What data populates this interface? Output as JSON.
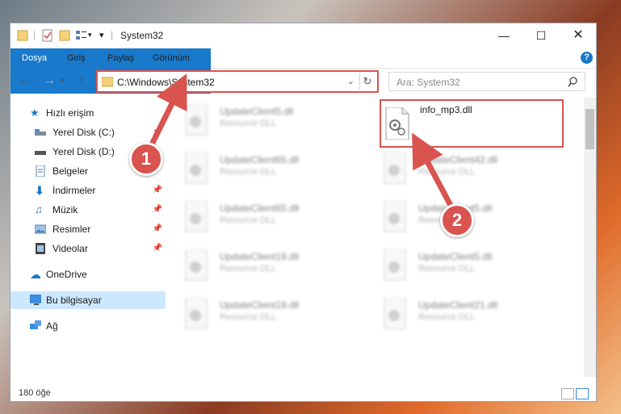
{
  "window": {
    "title": "System32"
  },
  "ribbon": {
    "tabs": [
      "Dosya",
      "Giriş",
      "Paylaş",
      "Görünüm"
    ]
  },
  "address": {
    "path": "C:\\Windows\\System32"
  },
  "search": {
    "placeholder": "Ara: System32"
  },
  "sidebar": {
    "items": [
      {
        "label": "Hızlı erişim",
        "icon": "star-icon"
      },
      {
        "label": "Yerel Disk (C:)",
        "icon": "drive-icon",
        "pinned": true
      },
      {
        "label": "Yerel Disk (D:)",
        "icon": "drive-icon",
        "pinned": true
      },
      {
        "label": "Belgeler",
        "icon": "document-icon",
        "pinned": true
      },
      {
        "label": "İndirmeler",
        "icon": "download-icon",
        "pinned": true
      },
      {
        "label": "Müzik",
        "icon": "music-icon",
        "pinned": true
      },
      {
        "label": "Resimler",
        "icon": "pictures-icon",
        "pinned": true
      },
      {
        "label": "Videolar",
        "icon": "video-icon",
        "pinned": true
      },
      {
        "label": "OneDrive",
        "icon": "cloud-icon"
      },
      {
        "label": "Bu bilgisayar",
        "icon": "computer-icon",
        "selected": true
      },
      {
        "label": "Ağ",
        "icon": "network-icon"
      }
    ]
  },
  "files": [
    {
      "name": "UpdateClient5.dll",
      "desc": "Resource DLL"
    },
    {
      "name": "info_mp3.dll",
      "desc": ""
    },
    {
      "name": "UpdateClient65.dll",
      "desc": "Resource DLL"
    },
    {
      "name": "UpdateClient42.dll",
      "desc": "Resource DLL"
    },
    {
      "name": "UpdateClient65.dll",
      "desc": "Resource DLL"
    },
    {
      "name": "UpdateClient5.dll",
      "desc": "Resource DLL"
    },
    {
      "name": "UpdateClient19.dll",
      "desc": "Resource DLL"
    },
    {
      "name": "UpdateClient5.dll",
      "desc": "Resource DLL"
    },
    {
      "name": "UpdateClient19.dll",
      "desc": "Resource DLL"
    },
    {
      "name": "UpdateClient21.dll",
      "desc": "Resource DLL"
    }
  ],
  "status": {
    "count": "180 öğe"
  },
  "callouts": {
    "one": "1",
    "two": "2"
  },
  "colors": {
    "accent": "#1979ca",
    "highlight": "#d9534f"
  }
}
